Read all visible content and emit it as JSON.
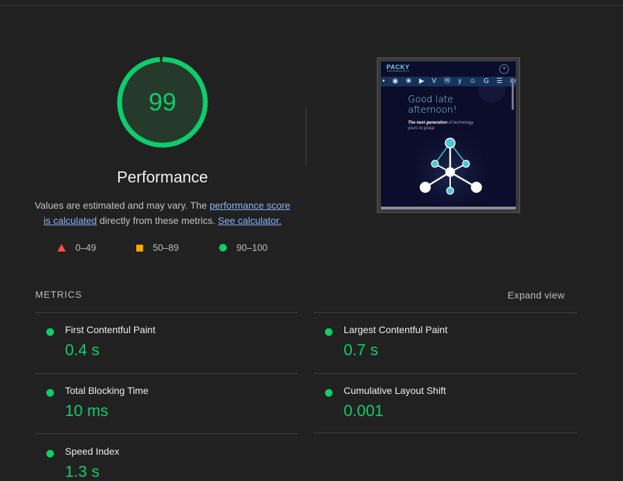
{
  "performance": {
    "score": "99",
    "title": "Performance",
    "score_fraction": 0.99,
    "ring_color": "#0cce6b"
  },
  "description": {
    "text_before": "Values are estimated and may vary. The ",
    "link_score": "performance score is calculated",
    "text_middle": " directly from these metrics. ",
    "link_calculator": "See calculator."
  },
  "legend": [
    {
      "shape": "triangle",
      "color": "#ff4e42",
      "label": "0–49"
    },
    {
      "shape": "square",
      "color": "#ffa400",
      "label": "50–89"
    },
    {
      "shape": "circle",
      "color": "#0cce6b",
      "label": "90–100"
    }
  ],
  "thumbnail": {
    "logo": "PACKY",
    "logo_sub": "TECHNOLOGY",
    "menu_icon": "hamburger-icon",
    "icon_strip": "• ◉ ❀ ▶ V Ⓦ y ☺ G ☰ in ●",
    "greeting_line1": "Good late",
    "greeting_line2": "afternoon!",
    "sub_bold": "The next generation",
    "sub_rest": " of technology,",
    "sub_line2": "yours to grasp."
  },
  "metrics": {
    "header": "METRICS",
    "expand_label": "Expand view",
    "items": [
      {
        "title": "First Contentful Paint",
        "value": "0.4 s",
        "status": "good"
      },
      {
        "title": "Largest Contentful Paint",
        "value": "0.7 s",
        "status": "good"
      },
      {
        "title": "Total Blocking Time",
        "value": "10 ms",
        "status": "good"
      },
      {
        "title": "Cumulative Layout Shift",
        "value": "0.001",
        "status": "good"
      },
      {
        "title": "Speed Index",
        "value": "1.3 s",
        "status": "good"
      }
    ]
  },
  "colors": {
    "background": "#212121",
    "good": "#0cce6b",
    "average": "#ffa400",
    "fail": "#ff4e42",
    "link": "#8ab4f8"
  }
}
